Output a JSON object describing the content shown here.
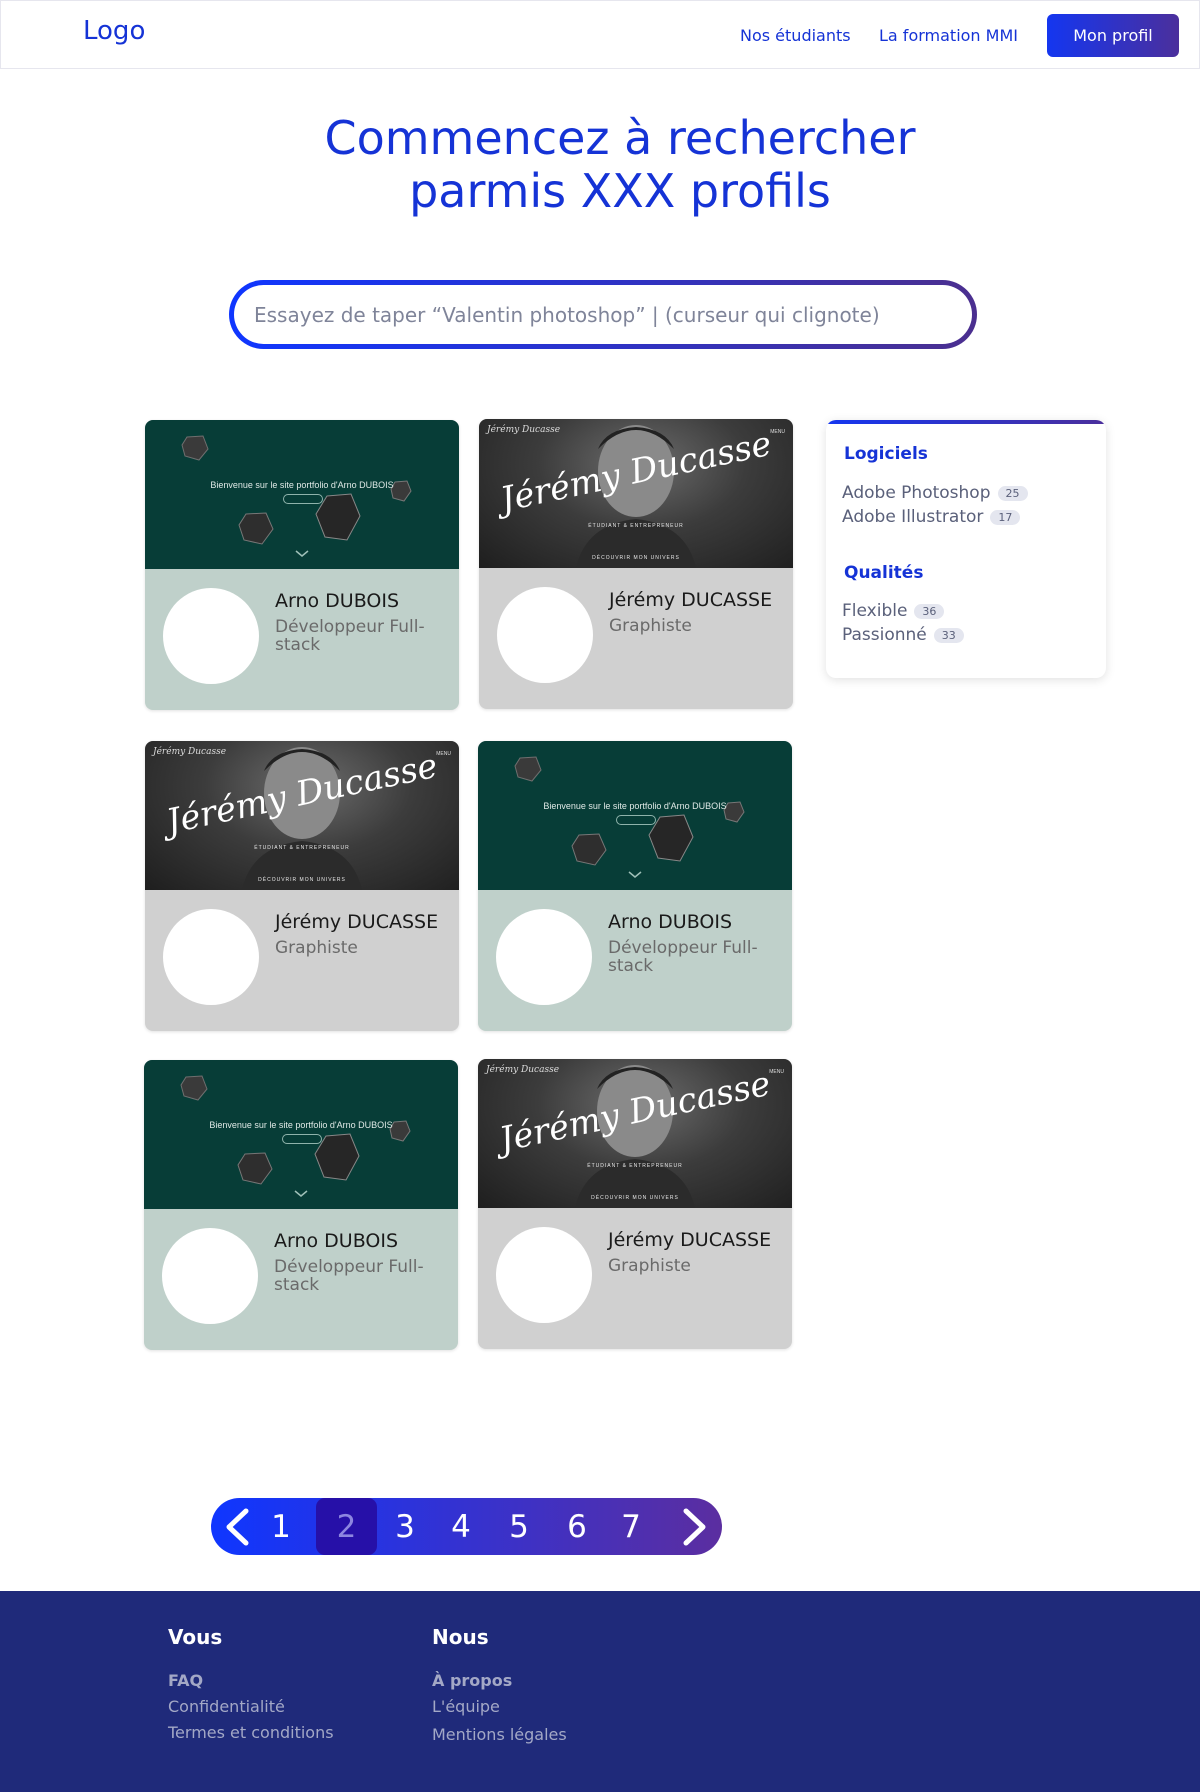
{
  "header": {
    "logo": "Logo",
    "nav": [
      "Nos étudiants",
      "La formation MMI"
    ],
    "profile_button": "Mon profil"
  },
  "hero": {
    "line1": "Commencez à rechercher",
    "line2": "parmis XXX profils"
  },
  "search": {
    "placeholder": "Essayez de taper “Valentin photoshop” | (curseur qui clignote)"
  },
  "cards": [
    {
      "name": "Arno DUBOIS",
      "role": "Développeur Full-stack",
      "banner_text": "Bienvenue sur le site portfolio d'Arno DUBOIS"
    },
    {
      "name": "Jérémy DUCASSE",
      "role": "Graphiste",
      "banner_title": "Jérémy Ducasse",
      "banner_sub": "ÉTUDIANT & ENTREPRENEUR",
      "banner_cta": "DÉCOUVRIR MON UNIVERS",
      "banner_menu": "MENU"
    },
    {
      "name": "Jérémy DUCASSE",
      "role": "Graphiste",
      "banner_title": "Jérémy Ducasse",
      "banner_sub": "ÉTUDIANT & ENTREPRENEUR",
      "banner_cta": "DÉCOUVRIR MON UNIVERS",
      "banner_menu": "MENU"
    },
    {
      "name": "Arno DUBOIS",
      "role": "Développeur Full-stack",
      "banner_text": "Bienvenue sur le site portfolio d'Arno DUBOIS"
    },
    {
      "name": "Arno DUBOIS",
      "role": "Développeur Full-stack",
      "banner_text": "Bienvenue sur le site portfolio d'Arno DUBOIS"
    },
    {
      "name": "Jérémy DUCASSE",
      "role": "Graphiste",
      "banner_title": "Jérémy Ducasse",
      "banner_sub": "ÉTUDIANT & ENTREPRENEUR",
      "banner_cta": "DÉCOUVRIR MON UNIVERS",
      "banner_menu": "MENU"
    }
  ],
  "filters": {
    "logiciels": {
      "heading": "Logiciels",
      "items": [
        {
          "label": "Adobe Photoshop",
          "count": "25"
        },
        {
          "label": "Adobe Illustrator",
          "count": "17"
        }
      ]
    },
    "qualites": {
      "heading": "Qualités",
      "items": [
        {
          "label": "Flexible",
          "count": "36"
        },
        {
          "label": "Passionné",
          "count": "33"
        }
      ]
    }
  },
  "pagination": {
    "prev": "<",
    "pages": [
      "1",
      "2",
      "3",
      "4",
      "5",
      "6",
      "7"
    ],
    "current": "2",
    "next": ">"
  },
  "footer": {
    "vous": {
      "heading": "Vous",
      "links": [
        "FAQ",
        "Confidentialité",
        "Termes et conditions"
      ]
    },
    "nous": {
      "heading": "Nous",
      "links": [
        "À propos",
        "L'équipe",
        "Mentions légales"
      ]
    }
  },
  "colors": {
    "primary": "#1533d6",
    "gradient_start": "#0f36ff",
    "gradient_end": "#5b2ea0",
    "footer_bg": "#1f2a7a",
    "card_green": "#bfd0ca",
    "card_gray": "#d0d0d0",
    "banner_green": "#073d37"
  }
}
